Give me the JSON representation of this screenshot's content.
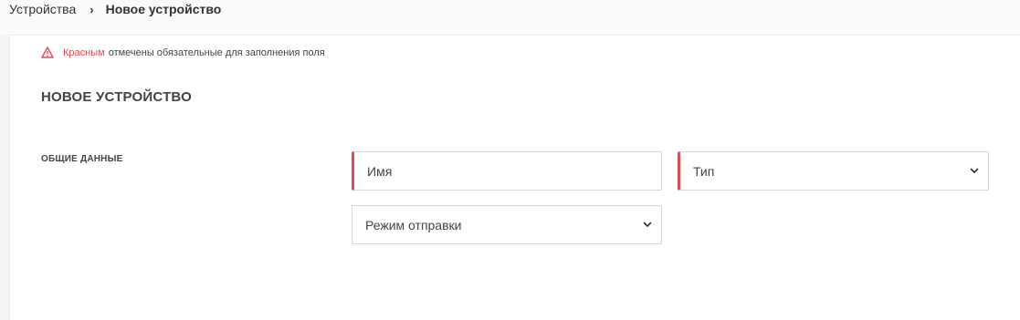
{
  "breadcrumb": {
    "parent": "Устройства",
    "separator": "›",
    "current": "Новое устройство"
  },
  "notice": {
    "highlight": "Красным",
    "text": "отмечены обязательные для заполнения поля",
    "icon": "warning-triangle-icon",
    "color": "#e5484d"
  },
  "form": {
    "title": "НОВОЕ УСТРОЙСТВО",
    "section_label": "ОБЩИЕ ДАННЫЕ",
    "name_placeholder": "Имя",
    "type_value": "Тип",
    "send_mode_value": "Режим отправки"
  },
  "colors": {
    "required_accent": "#e5484d"
  }
}
